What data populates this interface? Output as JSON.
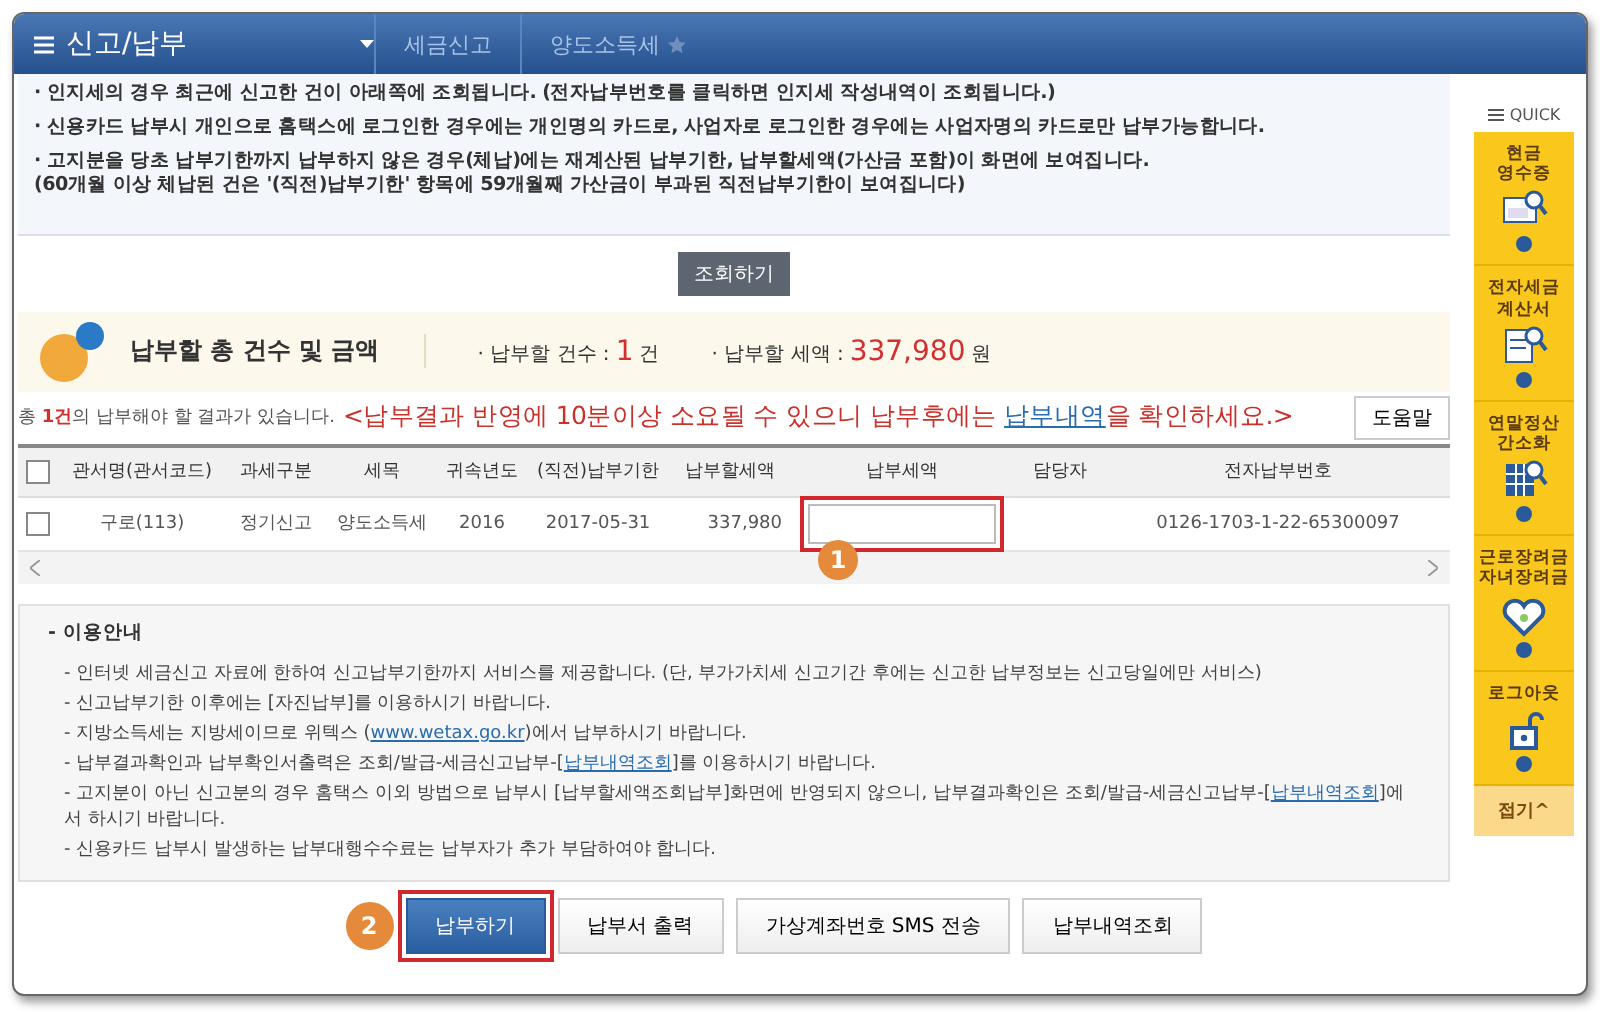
{
  "header": {
    "menu": "신고/납부",
    "breadcrumb": [
      "세금신고",
      "양도소득세"
    ]
  },
  "notices": [
    "· 인지세의 경우 최근에 신고한 건이 아래쪽에 조회됩니다. (전자납부번호를 클릭하면 인지세 작성내역이 조회됩니다.)",
    "· 신용카드 납부시 개인으로 홈택스에 로그인한 경우에는 개인명의 카드로, 사업자로 로그인한 경우에는 사업자명의 카드로만 납부가능합니다.",
    "· 고지분을 당초 납부기한까지 납부하지 않은 경우(체납)에는 재계산된 납부기한, 납부할세액(가산금 포함)이 화면에 보여집니다.\n(60개월 이상 체납된 건은 '(직전)납부기한' 항목에 59개월째 가산금이 부과된 직전납부기한이 보여집니다)"
  ],
  "search_button": "조회하기",
  "summary": {
    "title": "납부할 총 건수 및 금액",
    "items": [
      {
        "label": "· 납부할 건수 :",
        "value": "1",
        "unit": "건"
      },
      {
        "label": "· 납부할 세액 :",
        "value": "337,980",
        "unit": "원"
      }
    ]
  },
  "result_message": "총 **1건**의 납부해야 할 결과가 있습니다.",
  "warning": {
    "before": "<납부결과 반영에 10분이상 소요될 수 있으니 납부후에는 ",
    "link": "납부내역",
    "after": "을 확인하세요.>"
  },
  "help_button": "도움말",
  "table": {
    "select_all_checked": false,
    "columns": [
      "관서명(관서코드)",
      "과세구분",
      "세목",
      "귀속년도",
      "(직전)납부기한",
      "납부할세액",
      "납부세액",
      "담당자",
      "전자납부번호"
    ],
    "rows": [
      {
        "checked": false,
        "cells": [
          "구로(113)",
          "정기신고",
          "양도소득세",
          "2016",
          "2017-05-31",
          "337,980",
          "",
          "",
          "0126-1703-1-22-65300097"
        ]
      }
    ]
  },
  "guide": {
    "title": "- 이용안내",
    "items": [
      {
        "before": "- 인터넷 세금신고 자료에 한하여 신고납부기한까지 서비스를 제공합니다. (단, 부가가치세 신고기간 후에는 신고한 납부정보는 신고당일에만 서비스)"
      },
      {
        "before": "- 신고납부기한 이후에는 [자진납부]를 이용하시기 바랍니다."
      },
      {
        "before": "- 지방소득세는 지방세이므로 위텍스 (",
        "link": "www.wetax.go.kr",
        "after": ")에서 납부하시기 바랍니다."
      },
      {
        "before": "- 납부결과확인과 납부확인서출력은 조회/발급-세금신고납부-[",
        "link": "납부내역조회",
        "after": "]를 이용하시기 바랍니다."
      },
      {
        "before": "- 고지분이 아닌 신고분의 경우 홈택스 이외 방법으로 납부시 [납부할세액조회납부]화면에 반영되지 않으니, 납부결과확인은 조회/발급-세금신고납부-[",
        "link": "납부내역조회",
        "after": "]에서 하시기 바랍니다."
      },
      {
        "before": "- 신용카드 납부시 발생하는 납부대행수수료는 납부자가 추가 부담하여야 합니다."
      }
    ]
  },
  "actions": [
    {
      "label": "납부하기",
      "kind": "primary"
    },
    {
      "label": "납부서 출력",
      "kind": "normal"
    },
    {
      "label": "가상계좌번호 SMS 전송",
      "kind": "normal"
    },
    {
      "label": "납부내역조회",
      "kind": "normal"
    }
  ],
  "steps": [
    "1",
    "2"
  ],
  "quick": {
    "title": "QUICK",
    "items": [
      {
        "label": "현금\n영수증",
        "kind": "receipt"
      },
      {
        "label": "전자세금\n계산서",
        "kind": "invoice"
      },
      {
        "label": "연말정산\n간소화",
        "kind": "sheet"
      },
      {
        "label": "근로장려금\n자녀장려금",
        "kind": "heart"
      },
      {
        "label": "로그아웃",
        "kind": "lock"
      }
    ],
    "fold": "접기^"
  }
}
